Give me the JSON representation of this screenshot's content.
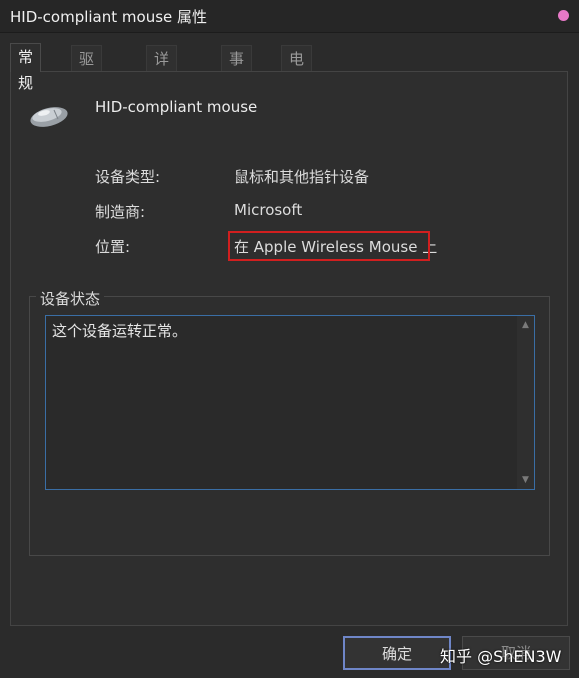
{
  "window": {
    "title": "HID-compliant mouse 属性"
  },
  "tabs": [
    {
      "label": "常规",
      "active": true
    },
    {
      "label": "驱动程序",
      "active": false
    },
    {
      "label": "详细信息",
      "active": false
    },
    {
      "label": "事件",
      "active": false
    },
    {
      "label": "电源管理",
      "active": false
    }
  ],
  "device": {
    "icon": "mouse-icon",
    "name": "HID-compliant mouse",
    "properties": [
      {
        "label": "设备类型:",
        "value": "鼠标和其他指针设备"
      },
      {
        "label": "制造商:",
        "value": "Microsoft"
      },
      {
        "label": "位置:",
        "value": "在 Apple Wireless Mouse 上"
      }
    ]
  },
  "status": {
    "group_title": "设备状态",
    "text": "这个设备运转正常。"
  },
  "buttons": {
    "ok": "确定",
    "cancel": "取消"
  },
  "watermark": "知乎 @ShEN3W",
  "colors": {
    "highlight": "#d11f1f",
    "accent": "#6f86c8",
    "close_dot": "#e879c7"
  }
}
